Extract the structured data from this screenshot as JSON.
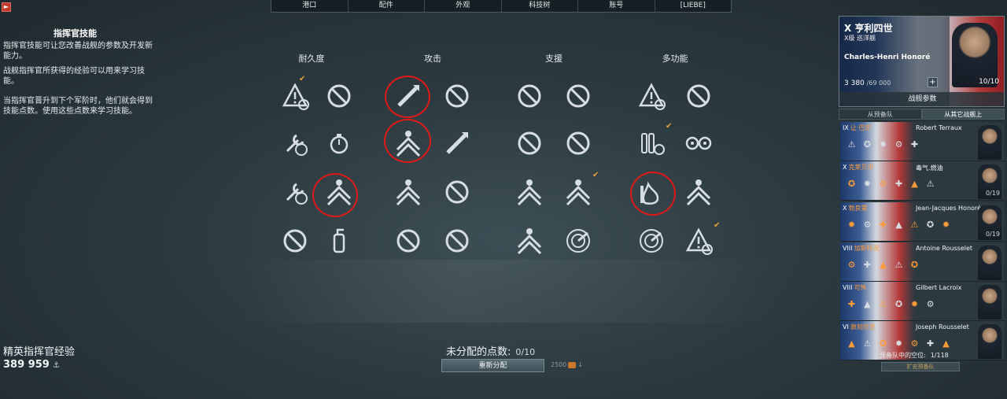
{
  "nav": {
    "tabs": [
      "港口",
      "配件",
      "外观",
      "科技树",
      "账号",
      "[LIEBE]"
    ]
  },
  "close_button": "►",
  "left": {
    "title": "指挥官技能",
    "para1": "指挥官技能可让您改善战舰的参数及开发新能力。",
    "para2": "战舰指挥官所获得的经验可以用来学习技能。",
    "para3": "当指挥官晋升到下个军阶时，他们就会得到技能点数。使用这些点数来学习技能。",
    "elite_label": "精英指挥官经验",
    "elite_value": "389 959"
  },
  "categories": [
    "耐久度",
    "攻击",
    "支援",
    "多功能"
  ],
  "skills_footer": {
    "unassigned_label": "未分配的点数:",
    "unassigned_value": "0/10",
    "reset_label": "重新分配",
    "cost_value": "2500"
  },
  "hero": {
    "tier": "X",
    "ship": "亨利四世",
    "ship_class": "X级 巡洋舰",
    "commander": "Charles-Henri Honoré",
    "xp_level": "3",
    "xp_value": "380",
    "xp_max": "/69 000",
    "points": "10",
    "points_max": "/10",
    "plus": "+",
    "params_label": "战舰参数"
  },
  "roster_tabs": [
    "从预备队",
    "从其它战舰上"
  ],
  "roster": [
    {
      "tier": "IX",
      "ship": "让·巴尔",
      "commander": "Robert Terraux",
      "orange": false,
      "points": ""
    },
    {
      "tier": "X",
      "ship": "克莱贝尔",
      "commander": "毒气.燃油",
      "orange": true,
      "points": "0/19"
    },
    {
      "tier": "X",
      "ship": "勃良第",
      "commander": "Jean-Jacques Honoré",
      "orange": true,
      "points": "0/19"
    },
    {
      "tier": "VIII",
      "ship": "加斯科涅",
      "commander": "Antoine Rousselet",
      "orange": true,
      "points": ""
    },
    {
      "tier": "VIII",
      "ship": "可怖",
      "commander": "Gilbert Lacroix",
      "orange": true,
      "points": ""
    },
    {
      "tier": "VI",
      "ship": "敦刻尔克",
      "commander": "Joseph Rousselet",
      "orange": true,
      "points": ""
    }
  ],
  "reserve": {
    "label": "预备队中的空位:",
    "value": "1/118",
    "expand_label": "扩充预备队"
  },
  "colors": {
    "accent_orange": "#ff9c38",
    "highlight_ring": "#e01818",
    "check": "#e8a33a"
  }
}
